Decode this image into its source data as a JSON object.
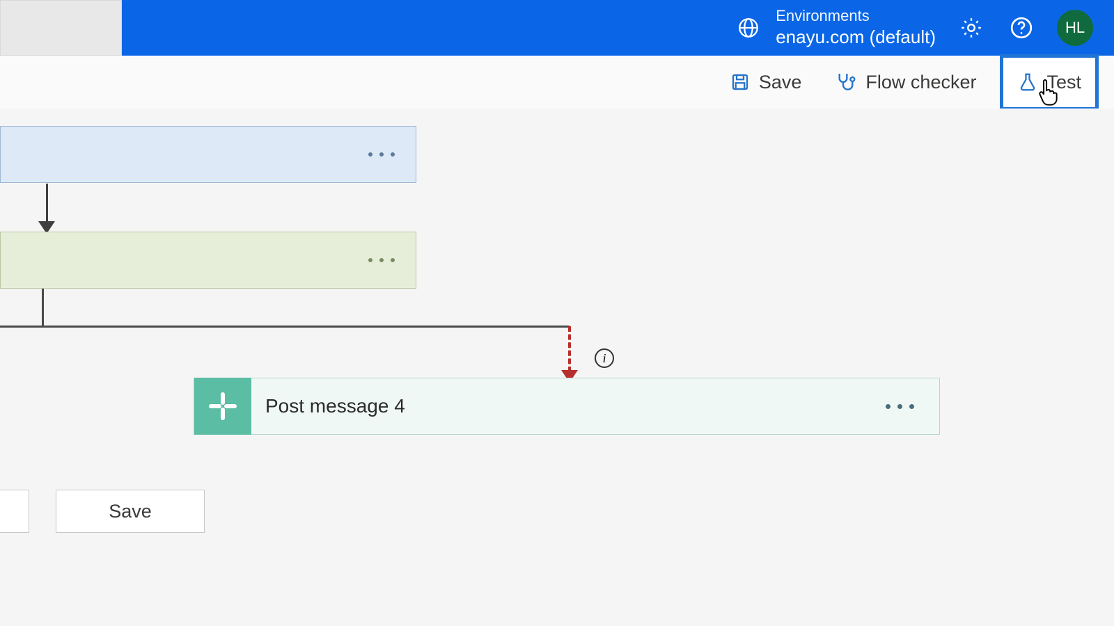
{
  "header": {
    "env_label": "Environments",
    "env_name": "enayu.com (default)",
    "avatar_initials": "HL"
  },
  "toolbar": {
    "save_label": "Save",
    "flow_checker_label": "Flow checker",
    "test_label": "Test"
  },
  "canvas": {
    "action_title": "Post message 4"
  },
  "footer": {
    "save_label": "Save"
  }
}
